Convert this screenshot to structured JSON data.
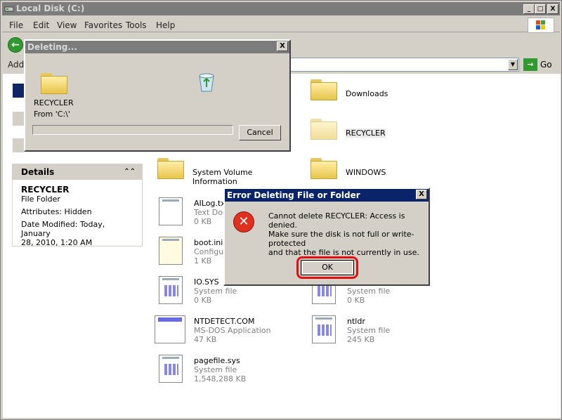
{
  "window": {
    "title": "Local Disk (C:)",
    "minimize": "_",
    "maximize": "□",
    "close": "X"
  },
  "menu": [
    "File",
    "Edit",
    "View",
    "Favorites",
    "Tools",
    "Help"
  ],
  "address": {
    "label": "Address",
    "value": "",
    "go_label": "Go"
  },
  "details": {
    "heading": "Details",
    "name": "RECYCLER",
    "type": "File Folder",
    "attributes": "Attributes: Hidden",
    "date_line1": "Date Modified: Today, January",
    "date_line2": "28, 2010, 1:20 AM"
  },
  "files": [
    {
      "name": "Downloads"
    },
    {
      "name": "RECYCLER"
    },
    {
      "name": "System Volume Information"
    },
    {
      "name": "WINDOWS"
    },
    {
      "name": "AILog.txt",
      "desc": "Text Document",
      "size": "0 KB"
    },
    {
      "name": "boot.ini",
      "desc": "Configuration Settings",
      "size": "1 KB"
    },
    {
      "name": "IO.SYS",
      "desc": "System file",
      "size": "0 KB"
    },
    {
      "name": "",
      "desc": "System file",
      "size": "0 KB"
    },
    {
      "name": "NTDETECT.COM",
      "desc": "MS-DOS Application",
      "size": "47 KB"
    },
    {
      "name": "ntldr",
      "desc": "System file",
      "size": "245 KB"
    },
    {
      "name": "pagefile.sys",
      "desc": "System file",
      "size": "1,548,288 KB"
    }
  ],
  "deleting_dialog": {
    "title": "Deleting...",
    "item": "RECYCLER",
    "from": "From 'C:\\'",
    "cancel": "Cancel",
    "progress": 0,
    "close": "X"
  },
  "error_dialog": {
    "title": "Error Deleting File or Folder",
    "message": "Cannot delete RECYCLER: Access is denied.",
    "detail_line1": "Make sure the disk is not full or write-protected",
    "detail_line2": "and that the file is not currently in use.",
    "ok": "OK",
    "close": "X"
  }
}
